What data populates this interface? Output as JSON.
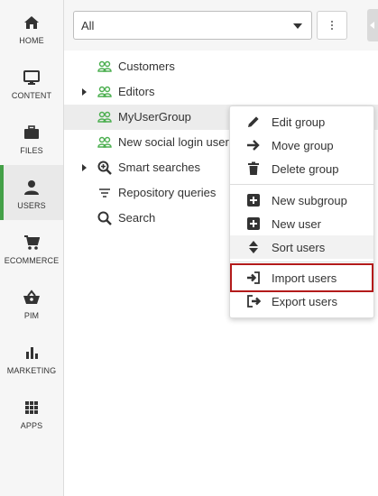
{
  "nav": {
    "items": [
      {
        "label": "HOME",
        "icon": "home-icon"
      },
      {
        "label": "CONTENT",
        "icon": "monitor-icon"
      },
      {
        "label": "FILES",
        "icon": "briefcase-icon"
      },
      {
        "label": "USERS",
        "icon": "user-icon",
        "active": true
      },
      {
        "label": "ECOMMERCE",
        "icon": "cart-icon"
      },
      {
        "label": "PIM",
        "icon": "basket-icon"
      },
      {
        "label": "MARKETING",
        "icon": "bar-chart-icon"
      },
      {
        "label": "APPS",
        "icon": "grid-icon"
      }
    ]
  },
  "filter": {
    "value": "All"
  },
  "tree": {
    "items": [
      {
        "label": "Customers",
        "icon": "user-group-icon",
        "expandable": false
      },
      {
        "label": "Editors",
        "icon": "user-group-icon",
        "expandable": true
      },
      {
        "label": "MyUserGroup",
        "icon": "user-group-icon",
        "expandable": false,
        "selected": true
      },
      {
        "label": "New social login users",
        "icon": "user-group-icon",
        "expandable": false
      },
      {
        "label": "Smart searches",
        "icon": "search-plus-icon",
        "expandable": true
      },
      {
        "label": "Repository queries",
        "icon": "filter-icon",
        "expandable": false
      },
      {
        "label": "Search",
        "icon": "search-icon",
        "expandable": false
      }
    ]
  },
  "context_menu": {
    "items": [
      {
        "label": "Edit group",
        "icon": "pencil-icon"
      },
      {
        "label": "Move group",
        "icon": "arrow-right-icon"
      },
      {
        "label": "Delete group",
        "icon": "trash-icon"
      },
      {
        "label": "New subgroup",
        "icon": "plus-square-icon"
      },
      {
        "label": "New user",
        "icon": "plus-square-icon"
      },
      {
        "label": "Sort users",
        "icon": "sort-icon"
      },
      {
        "label": "Import users",
        "icon": "sign-in-icon"
      },
      {
        "label": "Export users",
        "icon": "sign-out-icon"
      }
    ]
  },
  "colors": {
    "accent": "#43a047",
    "group_icon": "#4caf50",
    "highlight": "#b31b1b"
  }
}
